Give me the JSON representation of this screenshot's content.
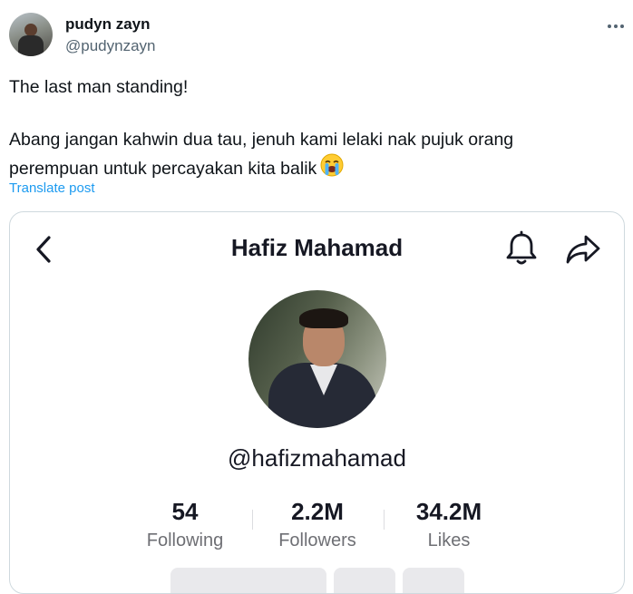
{
  "post": {
    "author_name": "pudyn zayn",
    "author_handle": "@pudynzayn",
    "text_line1": "The last man standing!",
    "text_line2": "Abang jangan kahwin dua tau, jenuh kami lelaki nak pujuk orang",
    "text_line3": "perempuan untuk percayakan kita balik",
    "emoji": "loudly-crying-face-icon",
    "translate_label": "Translate post"
  },
  "embedded_profile": {
    "title": "Hafiz Mahamad",
    "handle": "@hafizmahamad",
    "stats": [
      {
        "value": "54",
        "label": "Following"
      },
      {
        "value": "2.2M",
        "label": "Followers"
      },
      {
        "value": "34.2M",
        "label": "Likes"
      }
    ]
  },
  "colors": {
    "link": "#1d9bf0",
    "secondary_text": "#536471",
    "card_border": "#cfd9de"
  }
}
